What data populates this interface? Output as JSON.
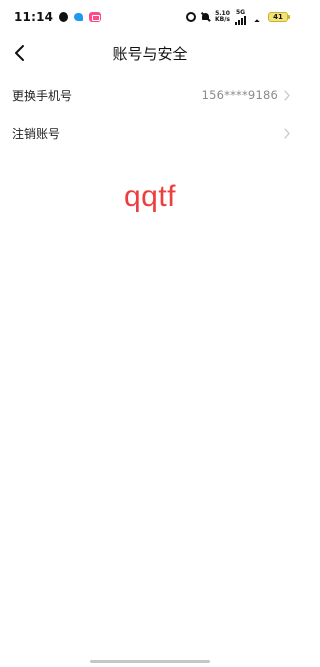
{
  "status_bar": {
    "time": "11:14",
    "net_speed_value": "5.10",
    "net_speed_unit": "KB/s",
    "network_type": "5G",
    "battery_level": "41"
  },
  "header": {
    "title": "账号与安全"
  },
  "settings": {
    "items": [
      {
        "label": "更换手机号",
        "value": "156****9186"
      },
      {
        "label": "注销账号",
        "value": ""
      }
    ]
  },
  "overlay": {
    "text": "qqtf",
    "color": "#ee3d3d"
  },
  "colors": {
    "background": "#ffffff",
    "text_primary": "#222222",
    "text_secondary": "#8a8a8a",
    "chevron": "#c4c4c4"
  }
}
